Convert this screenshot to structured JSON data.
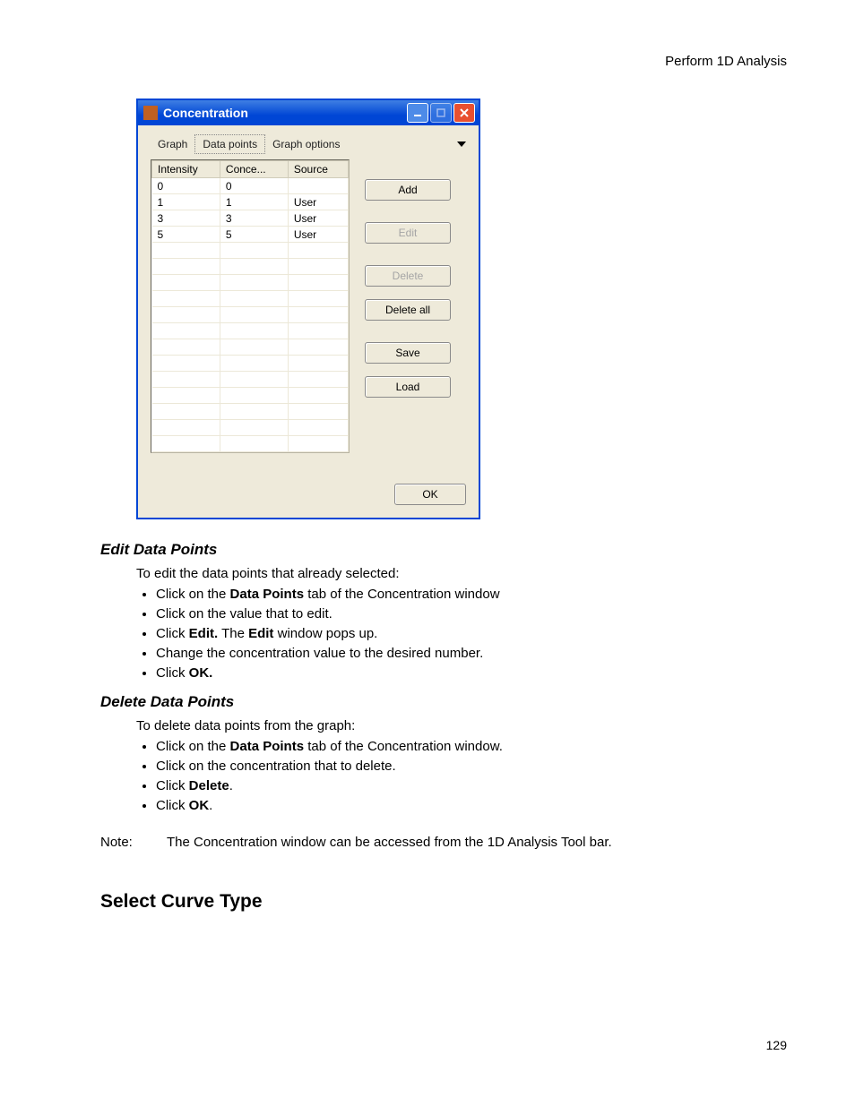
{
  "header": {
    "running": "Perform 1D Analysis"
  },
  "footer": {
    "page_number": "129"
  },
  "dialog": {
    "title": "Concentration",
    "tabs": {
      "t0": "Graph",
      "t1": "Data points",
      "t2": "Graph options"
    },
    "columns": {
      "c0": "Intensity",
      "c1": "Conce...",
      "c2": "Source"
    },
    "rows": [
      {
        "intensity": "0",
        "conc": "0",
        "source": ""
      },
      {
        "intensity": "1",
        "conc": "1",
        "source": "User"
      },
      {
        "intensity": "3",
        "conc": "3",
        "source": "User"
      },
      {
        "intensity": "5",
        "conc": "5",
        "source": "User"
      }
    ],
    "buttons": {
      "add": "Add",
      "edit": "Edit",
      "delete": "Delete",
      "delete_all": "Delete all",
      "save": "Save",
      "load": "Load",
      "ok": "OK"
    }
  },
  "sections": {
    "edit_title": "Edit Data Points",
    "edit_intro": "To edit the data points that already selected:",
    "edit_items": {
      "i0a": "Click on the ",
      "i0b": "Data Points",
      "i0c": " tab of the Concentration window",
      "i1": "Click on the value that to edit.",
      "i2a": "Click ",
      "i2b": "Edit.",
      "i2c": " The ",
      "i2d": "Edit",
      "i2e": " window pops up.",
      "i3": "Change the concentration value to the desired number.",
      "i4a": "Click ",
      "i4b": "OK."
    },
    "delete_title": "Delete Data Points",
    "delete_intro": "To delete data points from the graph:",
    "delete_items": {
      "i0a": "Click on the ",
      "i0b": "Data Points",
      "i0c": " tab of the Concentration window.",
      "i1": "Click on the concentration that to delete.",
      "i2a": "Click ",
      "i2b": "Delete",
      "i2c": ".",
      "i3a": "Click ",
      "i3b": "OK",
      "i3c": "."
    },
    "note_label": "Note:",
    "note_text": "The Concentration window can be accessed from the 1D Analysis Tool bar.",
    "select_curve": "Select Curve Type"
  }
}
